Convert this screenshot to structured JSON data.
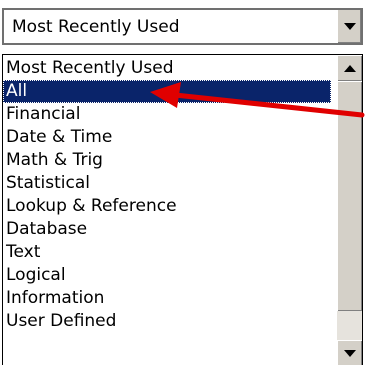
{
  "category_dropdown": {
    "selected_value": "Most Recently Used",
    "options": [
      "Most Recently Used",
      "All",
      "Financial",
      "Date & Time",
      "Math & Trig",
      "Statistical",
      "Lookup & Reference",
      "Database",
      "Text",
      "Logical",
      "Information",
      "User Defined"
    ],
    "highlighted_option": "All"
  },
  "annotation": {
    "arrow_color": "#e00000",
    "points_to": "All"
  },
  "colors": {
    "selection_bg": "#0a246a",
    "selection_text": "#ffffff",
    "button_face": "#d4d0c8"
  }
}
